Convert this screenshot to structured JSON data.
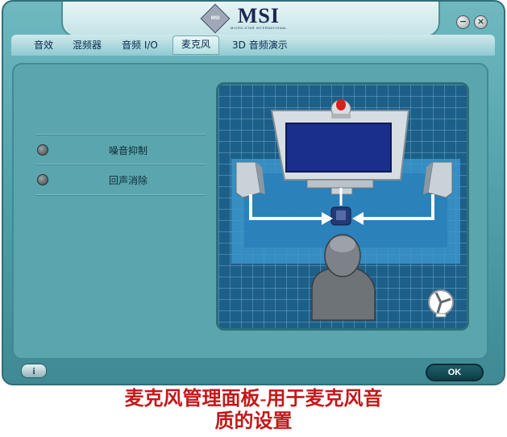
{
  "header": {
    "brand": "MSI",
    "emblem_text": "MSI",
    "tagline": "MICRO-STAR INTERNATIONAL"
  },
  "window_controls": {
    "minimize": "−",
    "close": "×"
  },
  "tabs": [
    {
      "label": "音效",
      "active": false
    },
    {
      "label": "混频器",
      "active": false
    },
    {
      "label": "音频 I/O",
      "active": false
    },
    {
      "label": "麦克风",
      "active": true
    },
    {
      "label": "3D 音频演示",
      "active": false
    }
  ],
  "options": [
    {
      "label": "噪音抑制",
      "enabled": false
    },
    {
      "label": "回声消除",
      "enabled": false
    }
  ],
  "icons": {
    "info": "info-icon",
    "mic": "webcam-microphone-icon",
    "monitor": "monitor-icon",
    "speaker": "speaker-icon",
    "person": "listener-icon",
    "fan": "fan-icon"
  },
  "buttons": {
    "info": "i",
    "ok": "OK"
  },
  "caption": {
    "line1": "麦克风管理面板-用于麦克风音",
    "line2": "质的设置"
  },
  "colors": {
    "accent": "#4f9ea8",
    "caption": "#c41818",
    "scene": "#1c5f88"
  }
}
